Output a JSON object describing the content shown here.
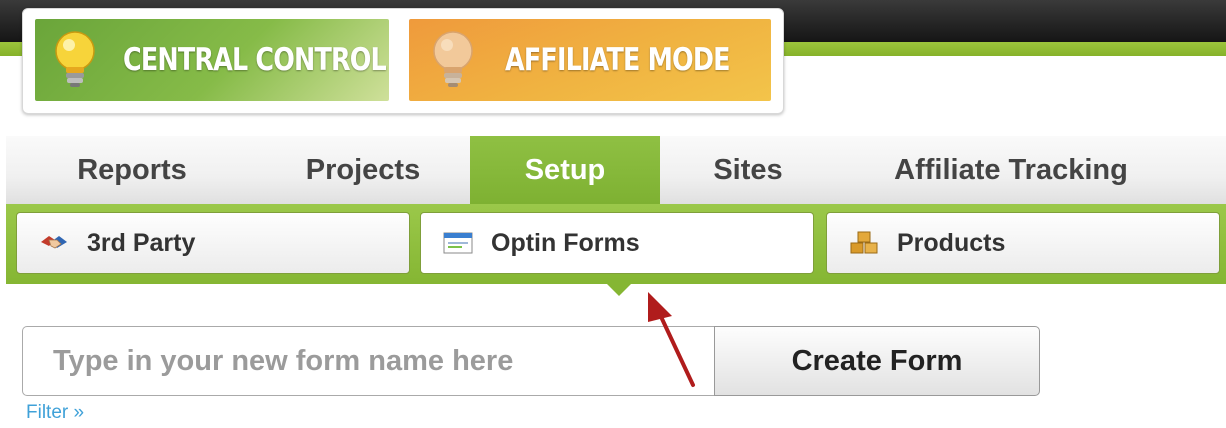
{
  "modes": {
    "central_label": "CENTRAL CONTROL",
    "affiliate_label": "AFFILIATE MODE"
  },
  "nav": {
    "tabs": [
      {
        "label": "Reports"
      },
      {
        "label": "Projects"
      },
      {
        "label": "Setup",
        "active": true
      },
      {
        "label": "Sites"
      },
      {
        "label": "Affiliate Tracking"
      }
    ]
  },
  "subnav": {
    "items": [
      {
        "label": "3rd Party",
        "icon": "handshake-icon"
      },
      {
        "label": "Optin Forms",
        "icon": "form-window-icon",
        "active": true
      },
      {
        "label": "Products",
        "icon": "boxes-icon"
      }
    ]
  },
  "form": {
    "placeholder": "Type in your new form name here",
    "value": "",
    "create_label": "Create Form"
  },
  "filter": {
    "label": "Filter »"
  },
  "colors": {
    "nav_active": "#86b735",
    "central_green": "#7cb444",
    "affiliate_orange": "#f0a83e",
    "link_blue": "#3fa1d8",
    "annotation_arrow": "#b01c1c"
  }
}
